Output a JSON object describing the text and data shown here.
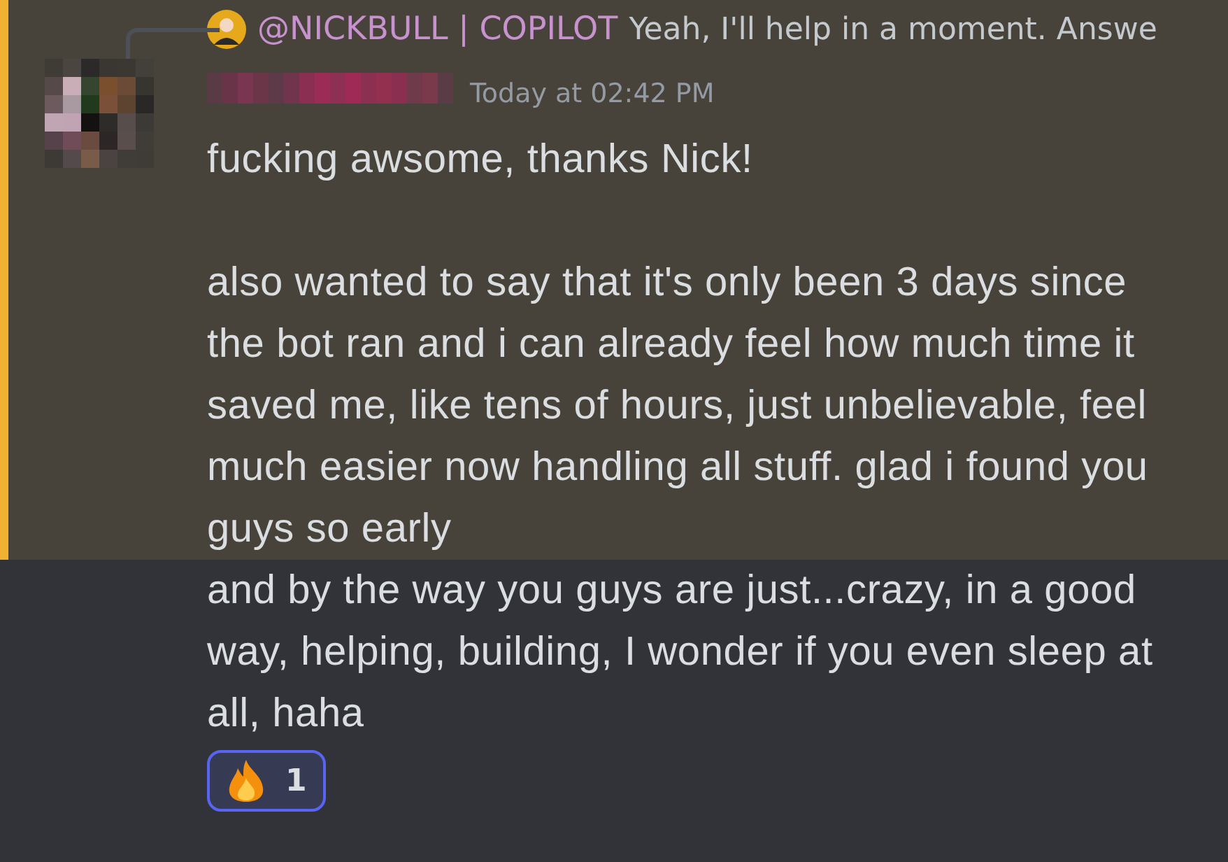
{
  "reply": {
    "author": "@NICKBULL | COPILOT",
    "preview": "Yeah, I'll help in a moment. Answe"
  },
  "header": {
    "timestamp": "Today at 02:42 PM"
  },
  "messages": [
    {
      "text": "fucking awsome, thanks Nick!\n\nalso wanted to say that it's only been 3 days since the bot ran and i can already feel how much time it saved me, like tens of hours, just unbelievable, feel much easier now handling all stuff. glad i found you guys so early",
      "highlighted": true
    },
    {
      "text": "and by the way you guys are just...crazy, in a good way, helping, building, I wonder if you even sleep at all, haha",
      "highlighted": false
    }
  ],
  "reactions": [
    {
      "count": "1",
      "selected": true
    }
  ]
}
